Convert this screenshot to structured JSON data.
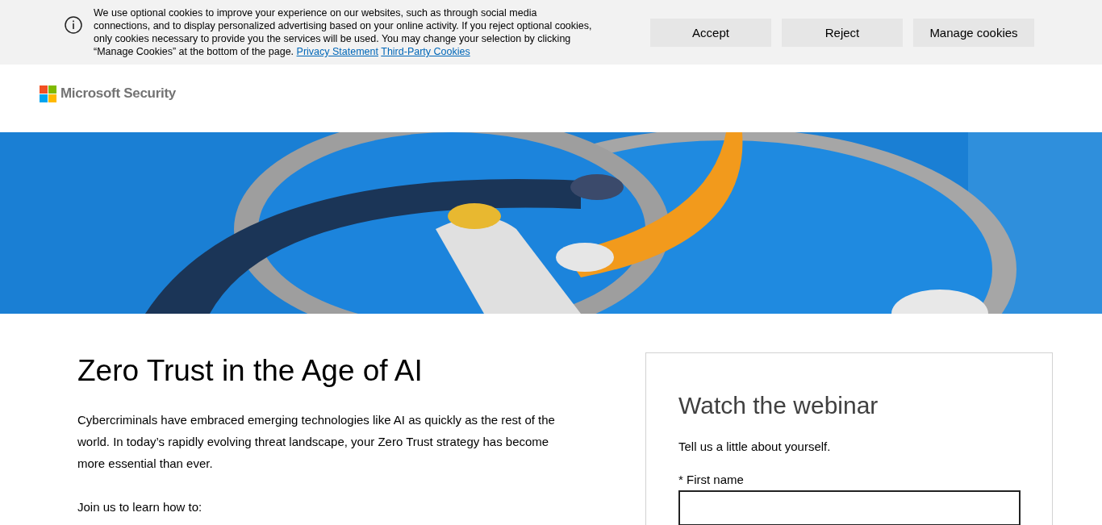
{
  "cookie_banner": {
    "message": "We use optional cookies to improve your experience on our websites, such as through social media connections, and to display personalized advertising based on your online activity. If you reject optional cookies, only cookies necessary to provide you the services will be used. You may change your selection by clicking “Manage Cookies” at the bottom of the page.",
    "links": [
      "Privacy Statement",
      "Third-Party Cookies"
    ],
    "buttons": [
      "Accept",
      "Reject",
      "Manage cookies"
    ]
  },
  "header": {
    "logo_text": "Microsoft Security"
  },
  "main": {
    "title": "Zero Trust in the Age of AI",
    "paragraphs": [
      "Cybercriminals have embraced emerging technologies like AI as quickly as the rest of the world. In today’s rapidly evolving threat landscape, your Zero Trust strategy has become more essential than ever.",
      "Join us to learn how to:"
    ]
  },
  "form": {
    "title": "Watch the webinar",
    "intro": "Tell us a little about yourself.",
    "fields": [
      {
        "label": "* First name"
      }
    ]
  }
}
